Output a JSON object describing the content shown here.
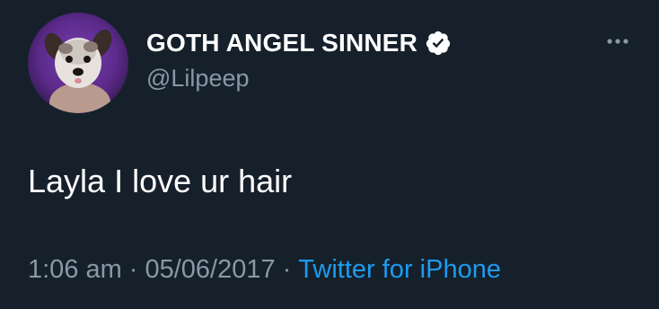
{
  "user": {
    "display_name": "GOTH ANGEL SINNER",
    "handle": "@Lilpeep",
    "verified": true
  },
  "tweet": {
    "text": "Layla I love ur hair",
    "time": "1:06 am",
    "separator": "·",
    "date": "05/06/2017",
    "source": "Twitter for iPhone"
  },
  "icons": {
    "verified": "verified-badge-icon",
    "more": "more-options-icon"
  },
  "colors": {
    "background": "#15202b",
    "text": "#ffffff",
    "secondary": "#8899a6",
    "link": "#1d9bf0"
  }
}
